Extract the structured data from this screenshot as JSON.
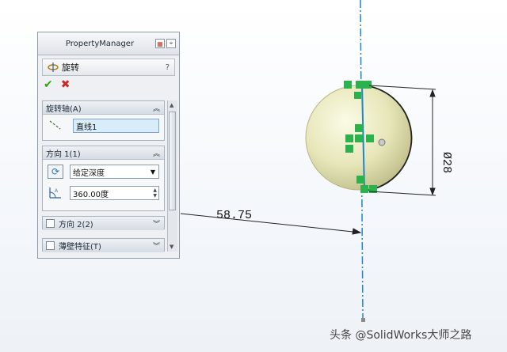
{
  "panel": {
    "title": "PropertyManager",
    "feature_name": "旋转",
    "help": "?"
  },
  "sections": {
    "axis": {
      "label": "旋转轴(A)",
      "value": "直线1"
    },
    "direction1": {
      "label": "方向 1(1)",
      "end_condition": "给定深度",
      "angle": "360.00度"
    },
    "direction2": {
      "label": "方向 2(2)"
    },
    "thin": {
      "label": "薄壁特征(T)"
    }
  },
  "viewport": {
    "dimension_distance": "58.75",
    "dimension_diameter": "Ø28"
  },
  "watermark": "头条 @SolidWorks大师之路",
  "colors": {
    "accent_green": "#2bb24c",
    "axis_blue": "#1c86c8",
    "ok": "#36a312",
    "cancel": "#c8282a"
  }
}
